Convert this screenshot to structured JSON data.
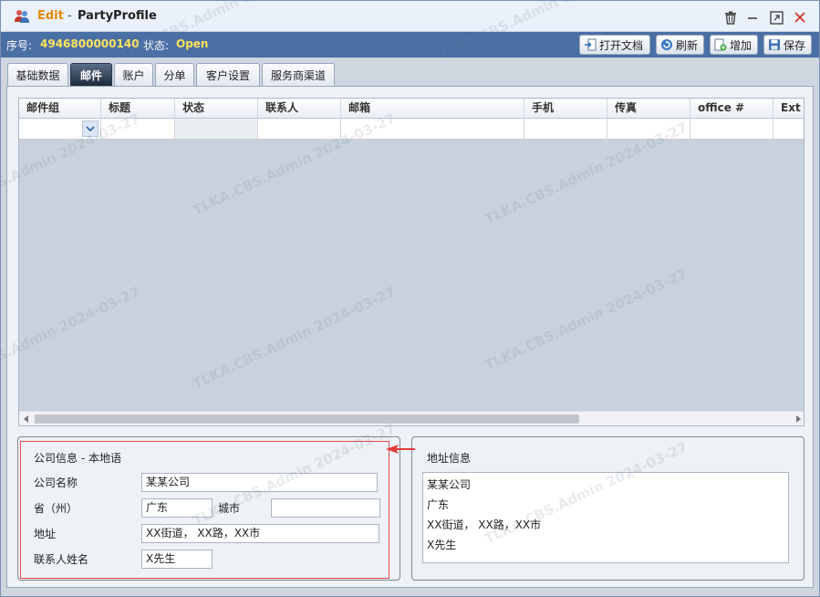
{
  "window": {
    "mode": "Edit",
    "separator": "-",
    "title": "PartyProfile"
  },
  "statusbar": {
    "seq_label": "序号:",
    "seq_value": "4946800000140",
    "state_label": "状态:",
    "state_value": "Open"
  },
  "toolbar": {
    "open_doc": "打开文档",
    "refresh": "刷新",
    "add": "增加",
    "save": "保存"
  },
  "tabs": [
    "基础数据",
    "邮件",
    "账户",
    "分单",
    "客户设置",
    "服务商渠道"
  ],
  "active_tab": "邮件",
  "grid": {
    "columns": [
      "邮件组",
      "标题",
      "状态",
      "联系人",
      "邮箱",
      "手机",
      "传真",
      "office #",
      "Ext #"
    ]
  },
  "company_panel": {
    "title": "公司信息 - 本地语",
    "name_label": "公司名称",
    "name_value": "某某公司",
    "province_label": "省（州）",
    "province_value": "广东",
    "city_label": "城市",
    "city_value": "",
    "address_label": "地址",
    "address_value": "XX街道， XX路，XX市",
    "contact_label": "联系人姓名",
    "contact_value": "X先生"
  },
  "address_panel": {
    "title": "地址信息",
    "lines": [
      "某某公司",
      "广东",
      "XX街道， XX路，XX市",
      "X先生"
    ]
  },
  "watermark": "TLKA.CBS.Admin 2024-03-27",
  "colors": {
    "title_mode": "#e58a00",
    "statusbar_bg": "#4a6fa5",
    "status_value": "#ffe45c",
    "highlight_border": "#e24a4a"
  }
}
